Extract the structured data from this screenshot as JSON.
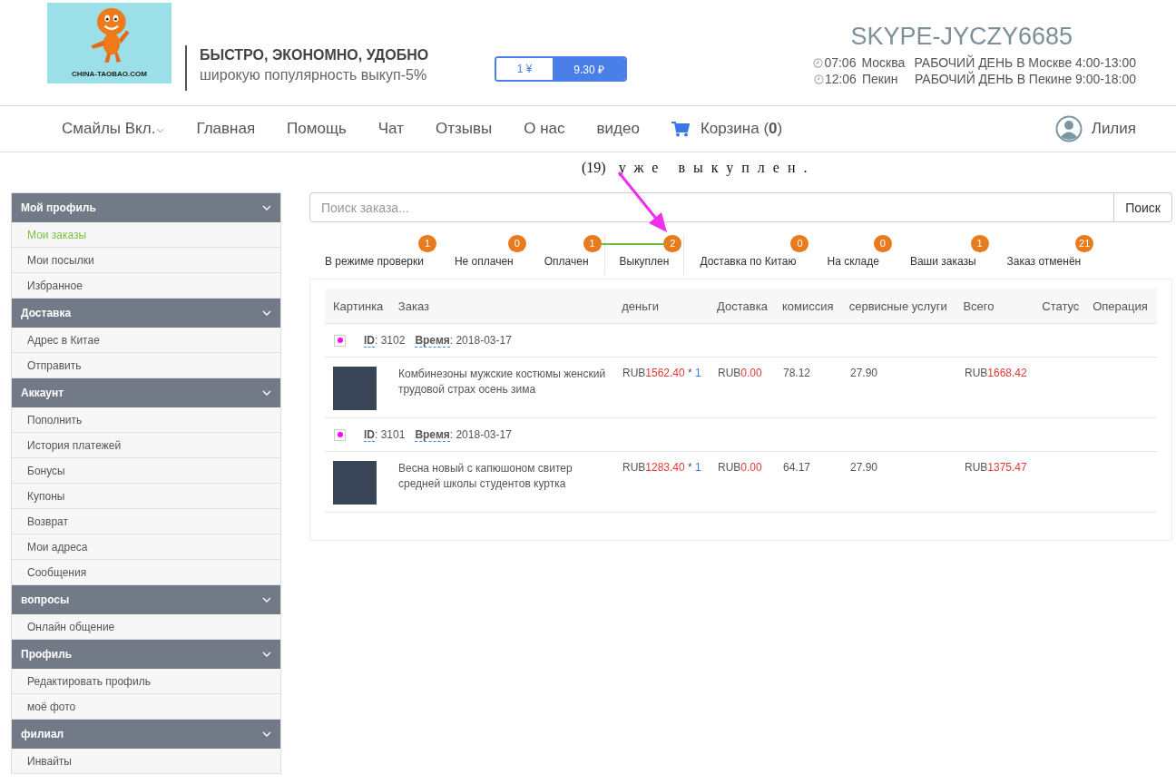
{
  "header": {
    "logo_text": "CHINA-TAOBAO.COM",
    "slogan": "БЫСТРО, ЭКОНОМНО, УДОБНО",
    "subslogan": "широкую популярность выкуп-5%",
    "currency": [
      {
        "label": "1 ¥",
        "selected": false
      },
      {
        "label": "9.30 ₽",
        "selected": true
      }
    ],
    "contact": "SKYPE-JYCZY6685",
    "clocks": [
      {
        "time": "07:06",
        "city": "Москва",
        "hours": "РАБОЧИЙ ДЕНЬ В Москве 4:00-13:00"
      },
      {
        "time": "12:06",
        "city": "Пекин",
        "hours": "РАБОЧИЙ ДЕНЬ В Пекине 9:00-18:00"
      }
    ]
  },
  "nav": {
    "items": [
      {
        "label": "Смайлы Вкл.",
        "kind": "dropdown"
      },
      {
        "label": "Главная",
        "kind": "link"
      },
      {
        "label": "Помощь",
        "kind": "link"
      },
      {
        "label": "Чат",
        "kind": "link"
      },
      {
        "label": "Отзывы",
        "kind": "link"
      },
      {
        "label": "О нас",
        "kind": "link"
      },
      {
        "label": "видео",
        "kind": "link"
      },
      {
        "label": "Корзина (**0**)",
        "kind": "cart"
      }
    ],
    "user": "Лилия"
  },
  "annotation": {
    "number": "(19)",
    "text": "уже выкуплен."
  },
  "sidebar": {
    "groups": [
      {
        "title": "Мой профиль",
        "items": [
          {
            "label": "Мои заказы",
            "selected": true
          },
          {
            "label": "Мои посылки",
            "selected": false
          },
          {
            "label": "Избранное",
            "selected": false
          }
        ]
      },
      {
        "title": "Доставка",
        "items": [
          {
            "label": "Адрес в Китае",
            "selected": false
          },
          {
            "label": "Отправить",
            "selected": false
          }
        ]
      },
      {
        "title": "Аккаунт",
        "items": [
          {
            "label": "Пополнить",
            "selected": false
          },
          {
            "label": "История платежей",
            "selected": false
          },
          {
            "label": "Бонусы",
            "selected": false
          },
          {
            "label": "Купоны",
            "selected": false
          },
          {
            "label": "Возврат",
            "selected": false
          },
          {
            "label": "Мои адреса",
            "selected": false
          },
          {
            "label": "Сообщения",
            "selected": false
          }
        ]
      },
      {
        "title": "вопросы",
        "items": [
          {
            "label": "Онлайн общение",
            "selected": false
          }
        ]
      },
      {
        "title": "Профиль",
        "items": [
          {
            "label": "Редактировать профиль",
            "selected": false
          },
          {
            "label": "моё фото",
            "selected": false
          }
        ]
      },
      {
        "title": "филиал",
        "items": [
          {
            "label": "Инвайты",
            "selected": false
          }
        ]
      }
    ]
  },
  "search": {
    "placeholder": "Поиск заказа...",
    "button": "Поиск"
  },
  "tabs": [
    {
      "label": "В режиме проверки",
      "count": "1",
      "selected": false
    },
    {
      "label": "Не оплачен",
      "count": "0",
      "selected": false
    },
    {
      "label": "Оплачен",
      "count": "1",
      "selected": false
    },
    {
      "label": "Выкуплен",
      "count": "2",
      "selected": true
    },
    {
      "label": "Доставка по Китаю",
      "count": "0",
      "selected": false
    },
    {
      "label": "На складе",
      "count": "0",
      "selected": false
    },
    {
      "label": "Ваши заказы",
      "count": "1",
      "selected": false
    },
    {
      "label": "Заказ отменён",
      "count": "21",
      "selected": false
    }
  ],
  "table": {
    "columns": [
      "Картинка",
      "Заказ",
      "деньги",
      "Доставка",
      "комиссия",
      "сервисные услуги",
      "Всего",
      "Статус",
      "Операция"
    ],
    "orders": [
      {
        "id": "**ID**: 3102",
        "time": "**Время**: 2018-03-17",
        "name": "Комбинезоны мужские костюмы женский трудовой страх осень зима",
        "currency": "RUB",
        "price": "1562.40",
        "qty_sep": " * ",
        "qty": "1",
        "shipping_currency": "RUB",
        "shipping": "0.00",
        "commission": "78.12",
        "service": "27.90",
        "total_currency": "RUB",
        "total": "1668.42"
      },
      {
        "id": "**ID**: 3101",
        "time": "**Время**: 2018-03-17",
        "name": "Весна новый с капюшоном свитер средней школы студентов куртка",
        "currency": "RUB",
        "price": "1283.40",
        "qty_sep": " * ",
        "qty": "1",
        "shipping_currency": "RUB",
        "shipping": "0.00",
        "commission": "64.17",
        "service": "27.90",
        "total_currency": "RUB",
        "total": "1375.47"
      }
    ]
  }
}
